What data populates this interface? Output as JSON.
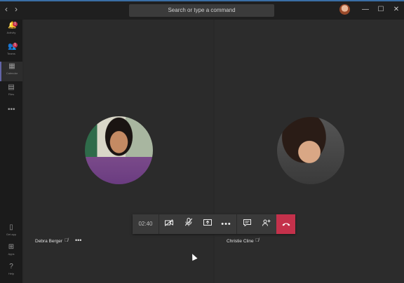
{
  "titlebar": {
    "back_icon": "‹",
    "forward_icon": "›",
    "search_placeholder": "Search or type a command",
    "minimize_icon": "—",
    "maximize_icon": "☐",
    "close_icon": "✕"
  },
  "rail": {
    "items": [
      {
        "label": "Activity",
        "icon": "🔔",
        "badge": "1"
      },
      {
        "label": "Teams",
        "icon": "👥",
        "badge": "1"
      },
      {
        "label": "Calendar",
        "icon": "▦",
        "badge": ""
      },
      {
        "label": "Files",
        "icon": "▤",
        "badge": ""
      },
      {
        "label": "",
        "icon": "•••",
        "badge": ""
      }
    ],
    "bottom_items": [
      {
        "label": "Get app",
        "icon": "▯"
      },
      {
        "label": "Apps",
        "icon": "⊞"
      },
      {
        "label": "Help",
        "icon": "?"
      }
    ]
  },
  "participants": [
    {
      "name": "Debra Berger",
      "muted": true
    },
    {
      "name": "Christie Cline",
      "muted": true
    }
  ],
  "toolbar": {
    "timer": "02:40",
    "video_icon": "video-off-icon",
    "mic_icon": "mic-off-icon",
    "share_icon": "share-screen-icon",
    "more_icon": "more-icon",
    "chat_icon": "chat-icon",
    "participants_icon": "add-participant-icon",
    "hangup_icon": "hang-up-icon"
  },
  "colors": {
    "accent": "#6264a7",
    "hangup": "#c4314b",
    "background": "#292929"
  }
}
